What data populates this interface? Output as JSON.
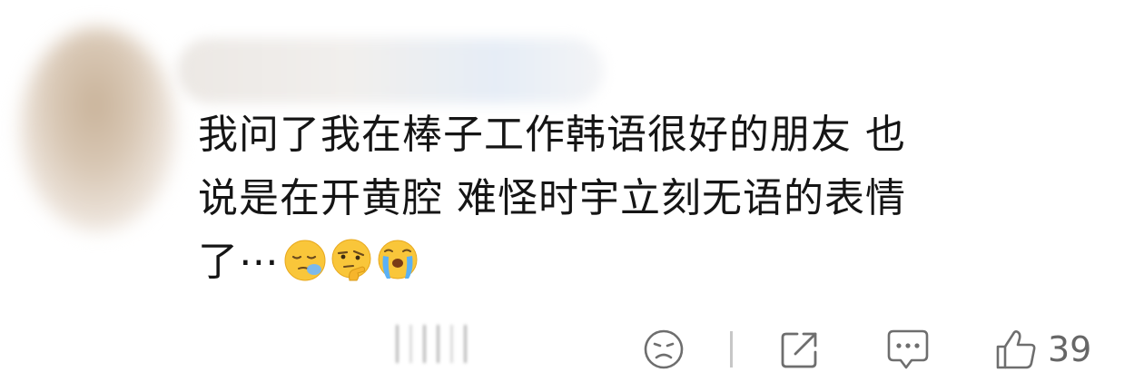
{
  "comment": {
    "lines": [
      "我问了我在棒子工作韩语很好的朋友 也",
      "说是在开黄腔 难怪时宇立刻无语的表情",
      "了⋯"
    ],
    "emojis": [
      "sleepy-face-emoji",
      "thinking-face-emoji",
      "crying-face-emoji"
    ]
  },
  "actions": {
    "react_icon": "sad-face-icon",
    "share_icon": "share-icon",
    "reply_icon": "comment-bubble-icon",
    "like_icon": "thumbs-up-icon",
    "like_count": "39"
  },
  "colors": {
    "text": "#151515",
    "icon": "#6e6e6e",
    "emoji_yellow": "#f9c63a"
  }
}
